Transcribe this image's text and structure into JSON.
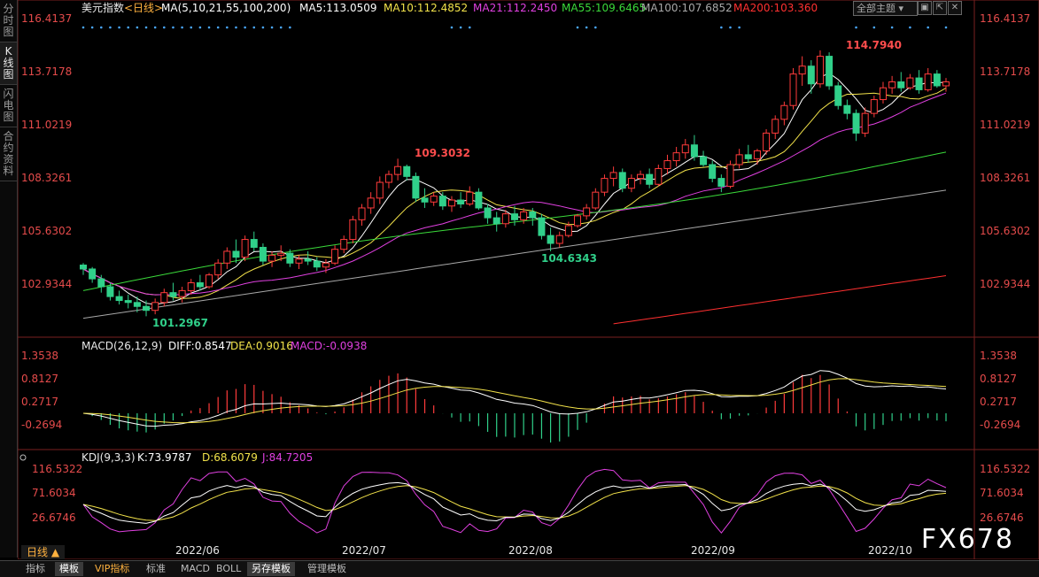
{
  "left_tabs": [
    "分时图",
    "K线图",
    "闪电图",
    "合约资料"
  ],
  "left_tab_active": 1,
  "header": {
    "symbol": "美元指数",
    "period": "<日线>",
    "ma_label": "MA(5,10,21,55,100,200)",
    "ma5": "MA5:113.0509",
    "ma10": "MA10:112.4852",
    "ma21": "MA21:112.2450",
    "ma55": "MA55:109.6465",
    "ma100": "MA100:107.6852",
    "ma200": "MA200:103.360",
    "theme_select": "全部主题",
    "window_buttons": [
      "▣",
      "⇱",
      "✕"
    ]
  },
  "price_axis": [
    "116.4137",
    "113.7178",
    "111.0219",
    "108.3261",
    "105.6302",
    "102.9344"
  ],
  "macd_axis": [
    "1.3538",
    "0.8127",
    "0.2717",
    "-0.2694"
  ],
  "kdj_axis": [
    "116.5322",
    "71.6034",
    "26.6746"
  ],
  "macd_header": {
    "label": "MACD(26,12,9)",
    "diff": "DIFF:0.8547",
    "dea": "DEA:0.9016",
    "macd": "MACD:-0.0938"
  },
  "kdj_header": {
    "label": "KDJ(9,3,3)",
    "k": "K:73.9787",
    "d": "D:68.6079",
    "j": "J:84.7205"
  },
  "annotations": {
    "high1": "109.3032",
    "high2": "114.7940",
    "low1": "101.2967",
    "low2": "104.6343"
  },
  "dates": [
    "2022/06",
    "2022/07",
    "2022/08",
    "2022/09",
    "2022/10"
  ],
  "period_label": "日线 ▲",
  "bottom_tabs": [
    "指标",
    "模板",
    "VIP指标",
    "标准",
    "MACD",
    "BOLL",
    "另存模板",
    "管理模板"
  ],
  "watermark": "FX678",
  "colors": {
    "up": "#ff3b3b",
    "down": "#30d08a",
    "ma5": "#ffffff",
    "ma10": "#f2e24a",
    "ma21": "#e040e0",
    "ma55": "#3ad93a",
    "ma100": "#a8a8a8",
    "ma200": "#ff3030",
    "axis": "#e54b4b"
  },
  "chart_data": {
    "type": "candlestick",
    "ylim": [
      101.0,
      116.4137
    ],
    "candles": [
      [
        103.9,
        104.0,
        103.4,
        103.7
      ],
      [
        103.7,
        103.8,
        103.0,
        103.2
      ],
      [
        103.2,
        103.4,
        102.5,
        102.8
      ],
      [
        102.8,
        103.0,
        102.1,
        102.3
      ],
      [
        102.3,
        102.6,
        101.9,
        102.1
      ],
      [
        102.1,
        102.4,
        101.7,
        102.0
      ],
      [
        102.0,
        102.3,
        101.5,
        101.8
      ],
      [
        101.8,
        102.1,
        101.3,
        101.6
      ],
      [
        101.6,
        102.2,
        101.4,
        102.0
      ],
      [
        102.0,
        102.7,
        101.8,
        102.5
      ],
      [
        102.5,
        103.0,
        102.1,
        102.3
      ],
      [
        102.3,
        102.8,
        102.0,
        102.6
      ],
      [
        102.6,
        103.2,
        102.4,
        103.0
      ],
      [
        103.0,
        103.4,
        102.6,
        102.8
      ],
      [
        102.8,
        103.5,
        102.7,
        103.4
      ],
      [
        103.4,
        104.2,
        103.2,
        104.0
      ],
      [
        104.0,
        104.8,
        103.7,
        104.6
      ],
      [
        104.6,
        105.2,
        104.0,
        104.3
      ],
      [
        104.3,
        105.4,
        104.1,
        105.2
      ],
      [
        105.2,
        105.6,
        104.6,
        104.8
      ],
      [
        104.8,
        105.0,
        103.9,
        104.1
      ],
      [
        104.1,
        104.6,
        103.8,
        104.4
      ],
      [
        104.4,
        104.9,
        104.1,
        104.5
      ],
      [
        104.5,
        104.7,
        103.8,
        104.0
      ],
      [
        104.0,
        104.4,
        103.7,
        104.2
      ],
      [
        104.2,
        104.6,
        103.9,
        104.1
      ],
      [
        104.1,
        104.3,
        103.6,
        103.8
      ],
      [
        103.8,
        104.2,
        103.5,
        104.0
      ],
      [
        104.0,
        104.9,
        103.9,
        104.7
      ],
      [
        104.7,
        105.4,
        104.5,
        105.2
      ],
      [
        105.2,
        106.4,
        105.0,
        106.2
      ],
      [
        106.2,
        107.0,
        105.9,
        106.8
      ],
      [
        106.8,
        107.6,
        106.5,
        107.3
      ],
      [
        107.3,
        108.4,
        107.0,
        108.1
      ],
      [
        108.1,
        108.7,
        107.8,
        108.5
      ],
      [
        108.5,
        109.3,
        108.2,
        108.9
      ],
      [
        108.9,
        109.0,
        108.2,
        108.4
      ],
      [
        108.4,
        108.6,
        107.1,
        107.3
      ],
      [
        107.3,
        107.8,
        106.8,
        107.1
      ],
      [
        107.1,
        107.6,
        106.9,
        107.4
      ],
      [
        107.4,
        107.6,
        106.7,
        106.9
      ],
      [
        106.9,
        107.4,
        106.6,
        107.2
      ],
      [
        107.2,
        107.6,
        106.8,
        107.0
      ],
      [
        107.0,
        107.9,
        106.9,
        107.6
      ],
      [
        107.6,
        107.8,
        106.7,
        106.8
      ],
      [
        106.8,
        107.0,
        106.0,
        106.3
      ],
      [
        106.3,
        106.6,
        105.6,
        106.0
      ],
      [
        106.0,
        106.7,
        105.8,
        106.5
      ],
      [
        106.5,
        106.9,
        105.9,
        106.2
      ],
      [
        106.2,
        106.8,
        106.0,
        106.6
      ],
      [
        106.6,
        106.8,
        105.9,
        106.3
      ],
      [
        106.3,
        106.5,
        105.2,
        105.4
      ],
      [
        105.4,
        105.8,
        104.6,
        105.0
      ],
      [
        105.0,
        105.6,
        104.8,
        105.4
      ],
      [
        105.4,
        106.1,
        105.3,
        105.9
      ],
      [
        105.9,
        106.5,
        105.8,
        106.4
      ],
      [
        106.4,
        107.0,
        106.2,
        106.8
      ],
      [
        106.8,
        107.8,
        106.7,
        107.6
      ],
      [
        107.6,
        108.5,
        107.4,
        108.3
      ],
      [
        108.3,
        108.9,
        107.9,
        108.6
      ],
      [
        108.6,
        108.8,
        107.6,
        107.8
      ],
      [
        107.8,
        108.5,
        107.6,
        108.3
      ],
      [
        108.3,
        108.7,
        108.0,
        108.5
      ],
      [
        108.5,
        108.8,
        107.8,
        108.0
      ],
      [
        108.0,
        109.0,
        107.9,
        108.8
      ],
      [
        108.8,
        109.5,
        108.5,
        109.2
      ],
      [
        109.2,
        109.9,
        108.9,
        109.6
      ],
      [
        109.6,
        110.3,
        109.3,
        110.0
      ],
      [
        110.0,
        110.5,
        109.2,
        109.4
      ],
      [
        109.4,
        109.7,
        108.9,
        109.0
      ],
      [
        109.0,
        109.2,
        108.1,
        108.3
      ],
      [
        108.3,
        108.5,
        107.6,
        107.9
      ],
      [
        107.9,
        109.2,
        107.8,
        109.0
      ],
      [
        109.0,
        109.8,
        108.8,
        109.5
      ],
      [
        109.5,
        110.0,
        109.1,
        109.3
      ],
      [
        109.3,
        109.8,
        109.0,
        109.7
      ],
      [
        109.7,
        110.8,
        109.5,
        110.6
      ],
      [
        110.6,
        111.5,
        110.3,
        111.3
      ],
      [
        111.3,
        112.2,
        111.0,
        112.0
      ],
      [
        112.0,
        113.9,
        111.8,
        113.6
      ],
      [
        113.6,
        114.5,
        113.0,
        114.0
      ],
      [
        114.0,
        114.3,
        112.6,
        113.1
      ],
      [
        113.1,
        114.8,
        112.9,
        114.5
      ],
      [
        114.5,
        114.7,
        112.8,
        113.0
      ],
      [
        113.0,
        113.2,
        111.8,
        112.0
      ],
      [
        112.0,
        112.3,
        111.3,
        111.6
      ],
      [
        111.6,
        111.8,
        110.2,
        110.6
      ],
      [
        110.6,
        111.9,
        110.4,
        111.6
      ],
      [
        111.6,
        112.5,
        111.4,
        112.3
      ],
      [
        112.3,
        113.2,
        112.1,
        112.9
      ],
      [
        112.9,
        113.5,
        112.6,
        113.2
      ],
      [
        113.2,
        113.7,
        112.7,
        112.9
      ],
      [
        112.9,
        113.6,
        112.8,
        113.4
      ],
      [
        113.4,
        113.8,
        112.6,
        112.8
      ],
      [
        112.8,
        113.9,
        112.7,
        113.6
      ],
      [
        113.6,
        113.8,
        112.9,
        113.0
      ],
      [
        113.0,
        113.4,
        112.7,
        113.2
      ]
    ]
  }
}
